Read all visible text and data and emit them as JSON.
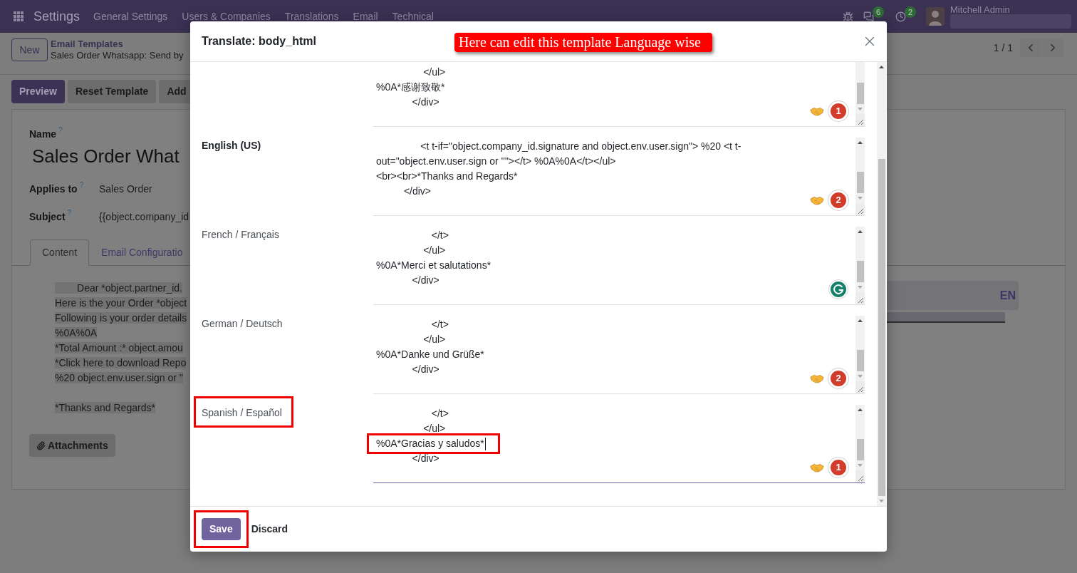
{
  "navbar": {
    "app": "Settings",
    "menu": [
      "General Settings",
      "Users & Companies",
      "Translations",
      "Email",
      "Technical"
    ],
    "counters": [
      {
        "kind": "messages",
        "count": "6"
      },
      {
        "kind": "activities",
        "count": "2"
      }
    ],
    "user": "Mitchell Admin"
  },
  "control_panel": {
    "new_button": "New",
    "breadcrumb": {
      "parent": "Email Templates",
      "current": "Sales Order Whatsapp: Send by"
    },
    "pager": "1 / 1"
  },
  "action_buttons": [
    {
      "label": "Preview",
      "primary": true
    },
    {
      "label": "Reset Template",
      "primary": false
    },
    {
      "label": "Add",
      "primary": false
    }
  ],
  "form": {
    "name_label": {
      "text": "Name",
      "help": "?"
    },
    "name": "Sales Order What",
    "fields": [
      {
        "label": "Applies to",
        "help": "?",
        "value": "Sales Order"
      },
      {
        "label": "Subject",
        "help": "?",
        "value": "{{object.company_id"
      }
    ],
    "tabs": [
      {
        "label": "Content",
        "selected": true
      },
      {
        "label": "Email Configuratio",
        "selected": false
      }
    ],
    "body_blocks": [
      [
        "        Dear *object.partner_id.",
        "Here is the your Order *object",
        "Following is your order details",
        "%0A%0A",
        "*Total Amount :* object.amou",
        "*Click here to download Repo",
        "%20 object.env.user.sign or ''"
      ],
      [
        "*Thanks and Regards*"
      ]
    ],
    "language_button": "EN",
    "attachments_button": "Attachments"
  },
  "dialog": {
    "title": "Translate: body_html",
    "callout": "Here can edit this template Language wise",
    "rows": [
      {
        "cut_top": true,
        "focused": false,
        "lines": [
          {
            "text": "                 </ul>"
          },
          {
            "text": "%0A*感谢致敬*"
          },
          {
            "text": "             </div>"
          }
        ],
        "indicator": {
          "kind": "count",
          "count": "1"
        }
      },
      {
        "language": "English (US)",
        "current": true,
        "highlighted": false,
        "cut_top": false,
        "focused": false,
        "lines": [
          {
            "text": "                <t t-if=\"object.company_id.signature and object.env.user.sign\"> %20 <t t-"
          },
          {
            "text": "out=\"object.env.user.sign or ''\"></t> %0A%0A</t></ul>"
          },
          {
            "text": "<br><br>*Thanks and Regards*"
          },
          {
            "text": "          </div>"
          }
        ],
        "indicator": {
          "kind": "count",
          "count": "2"
        }
      },
      {
        "language": "French / Français",
        "current": false,
        "highlighted": false,
        "cut_top": false,
        "focused": false,
        "lines": [
          {
            "text": "                    </t>"
          },
          {
            "text": "                 </ul>"
          },
          {
            "text": "%0A*Merci et salutations*"
          },
          {
            "text": "             </div>"
          }
        ],
        "indicator": {
          "kind": "logo"
        }
      },
      {
        "language": "German / Deutsch",
        "current": false,
        "highlighted": false,
        "cut_top": false,
        "focused": false,
        "lines": [
          {
            "text": "                    </t>"
          },
          {
            "text": "                 </ul>"
          },
          {
            "text": "%0A*Danke und Grüße*"
          },
          {
            "text": "             </div>"
          }
        ],
        "indicator": {
          "kind": "count",
          "count": "2"
        }
      },
      {
        "language": "Spanish / Español",
        "current": false,
        "highlighted": true,
        "cut_top": false,
        "focused": true,
        "lines": [
          {
            "text": "                    </t>",
            "highlighted": false,
            "cursor": false
          },
          {
            "text": "                 </ul>",
            "highlighted": false,
            "cursor": false
          },
          {
            "text": "%0A*Gracias y saludos*",
            "highlighted": true,
            "cursor": true
          },
          {
            "text": "             </div>",
            "highlighted": false,
            "cursor": false
          }
        ],
        "indicator": {
          "kind": "count",
          "count": "1"
        }
      }
    ],
    "buttons": [
      {
        "label": "Save",
        "primary": true,
        "highlighted": true
      },
      {
        "label": "Discard",
        "primary": false,
        "highlighted": false
      }
    ]
  }
}
